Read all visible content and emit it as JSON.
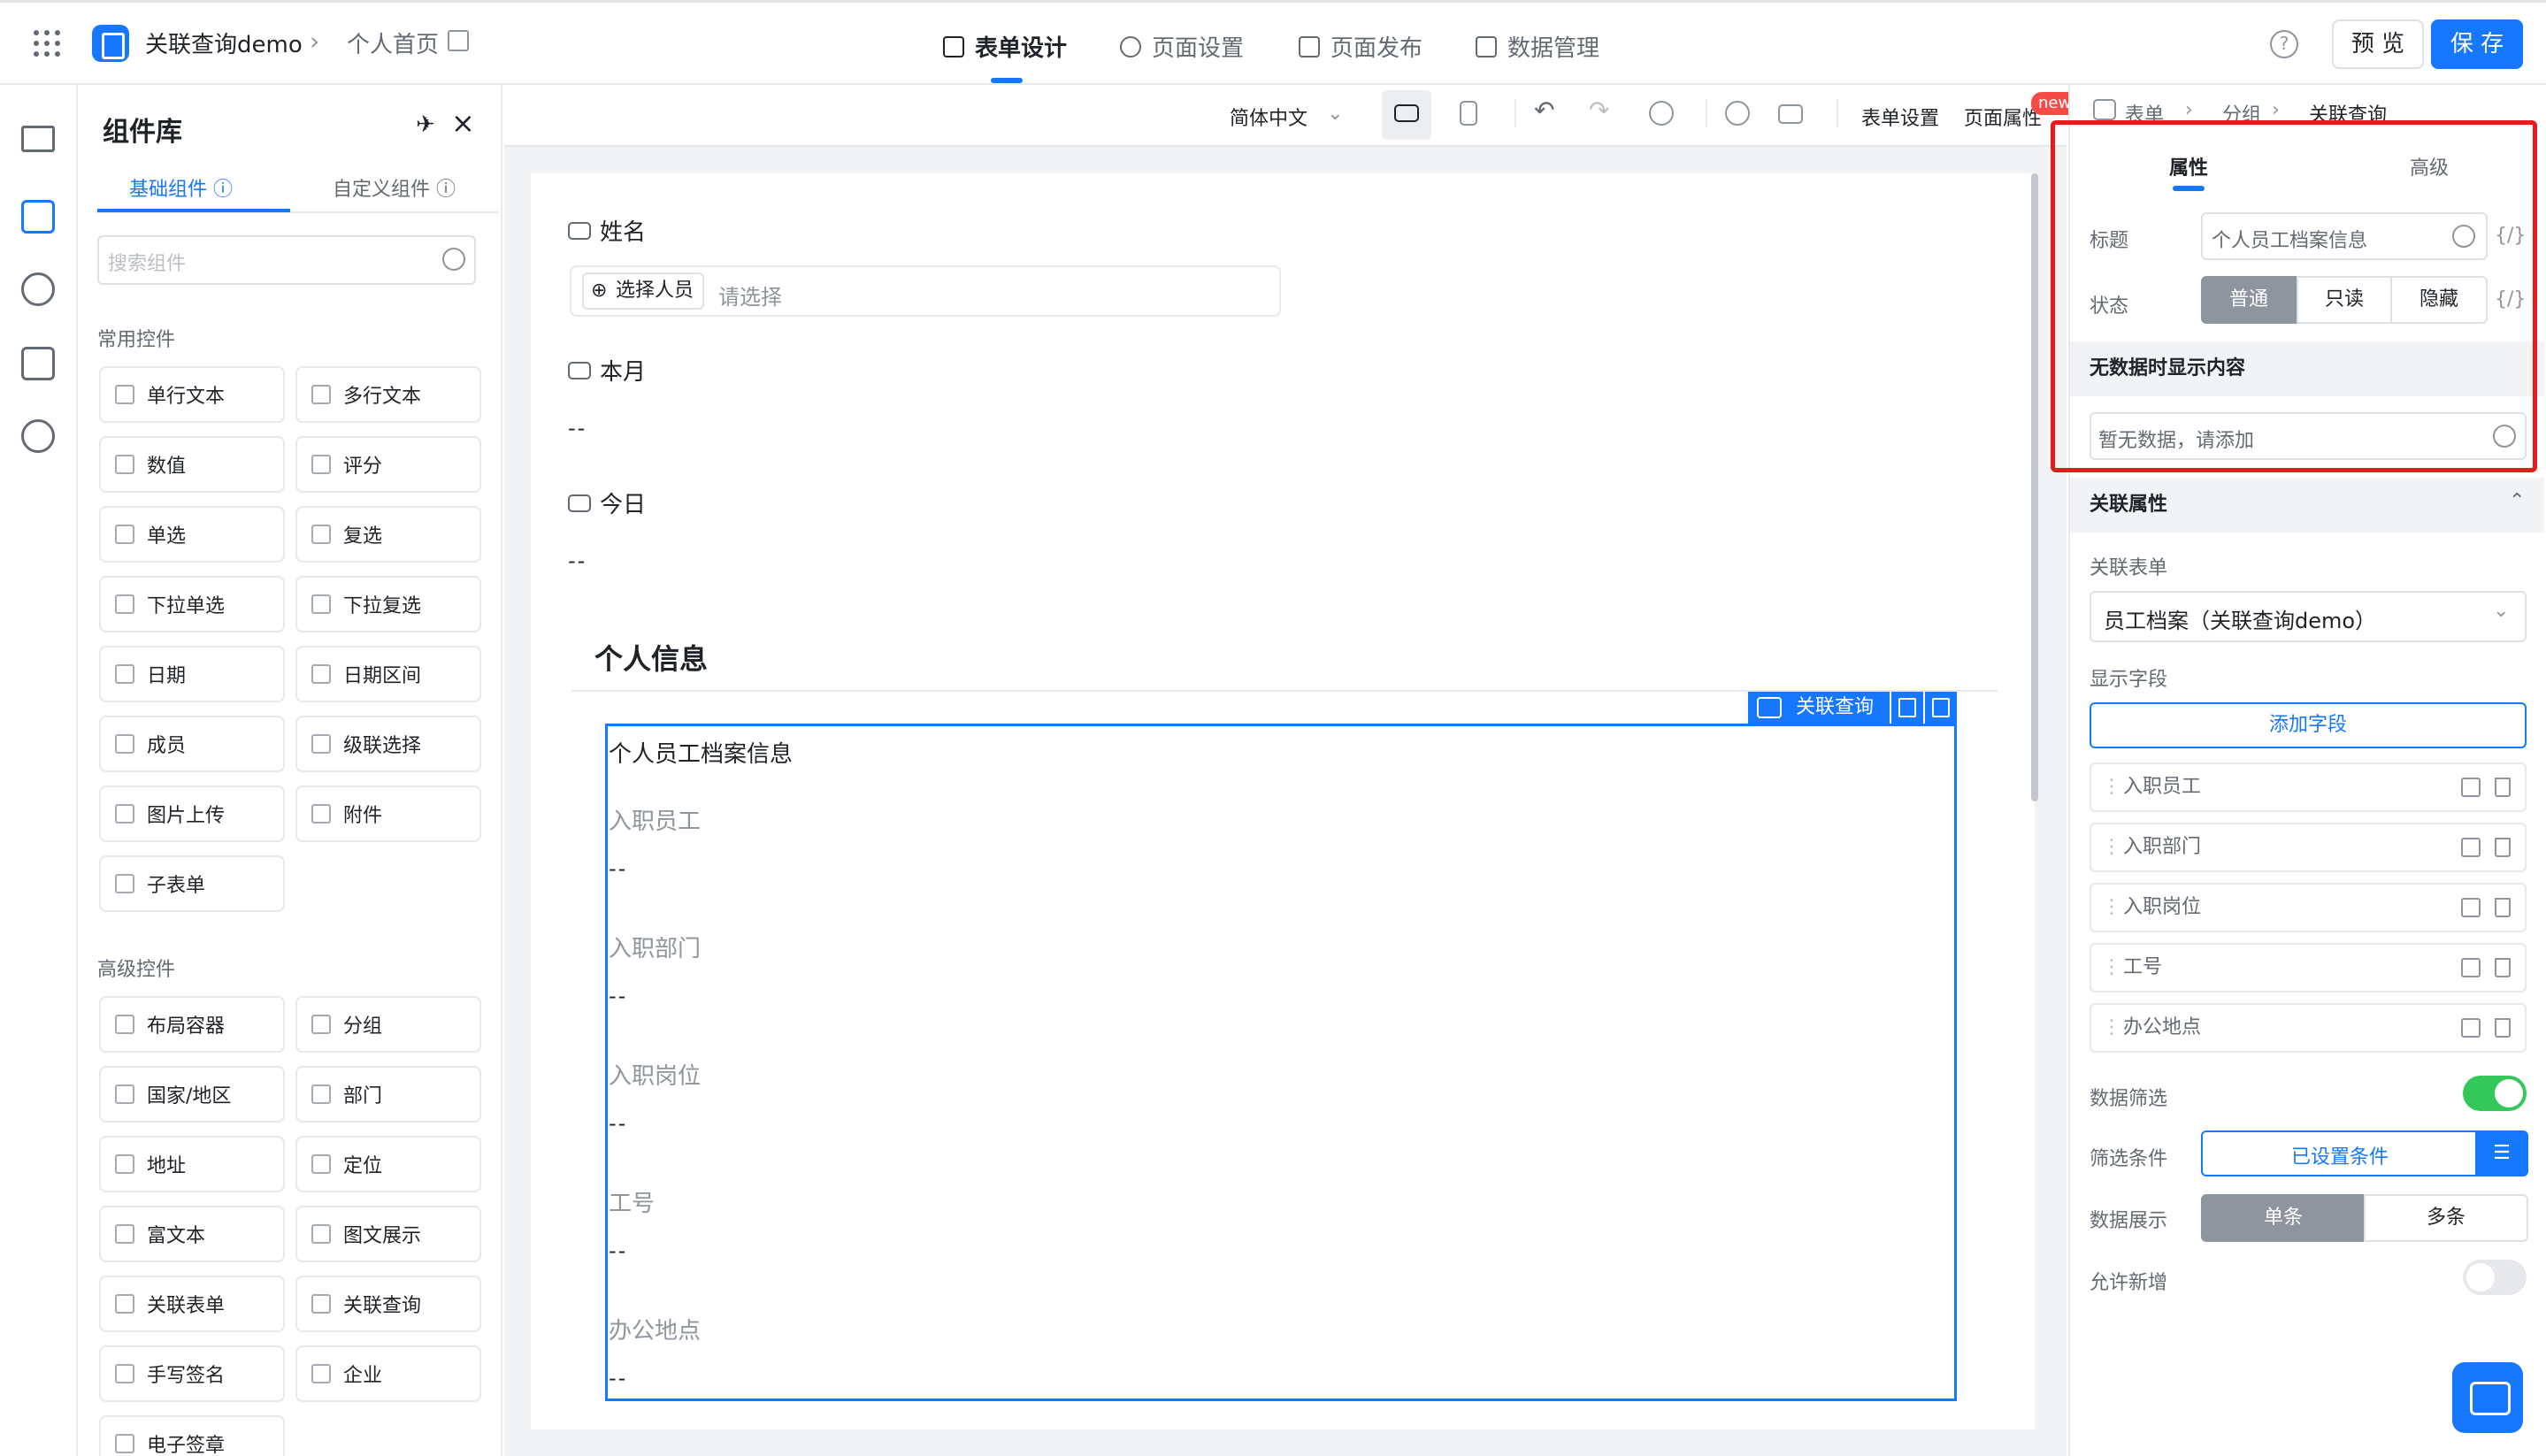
{
  "app": {
    "title": "关联查询demo",
    "page": "个人首页"
  },
  "nav_tabs": [
    {
      "label": "表单设计",
      "icon": "form-icon",
      "active": true
    },
    {
      "label": "页面设置",
      "icon": "gear-icon",
      "active": false
    },
    {
      "label": "页面发布",
      "icon": "send-icon",
      "active": false
    },
    {
      "label": "数据管理",
      "icon": "table-icon",
      "active": false
    }
  ],
  "header": {
    "help": "?",
    "preview_label": "预 览",
    "save_label": "保 存"
  },
  "library": {
    "title": "组件库",
    "tabs": [
      "基础组件",
      "自定义组件"
    ],
    "search_placeholder": "搜索组件",
    "common_title": "常用控件",
    "common": [
      "单行文本",
      "多行文本",
      "数值",
      "评分",
      "单选",
      "复选",
      "下拉单选",
      "下拉复选",
      "日期",
      "日期区间",
      "成员",
      "级联选择",
      "图片上传",
      "附件",
      "子表单"
    ],
    "advanced_title": "高级控件",
    "advanced": [
      "布局容器",
      "分组",
      "国家/地区",
      "部门",
      "地址",
      "定位",
      "富文本",
      "图文展示",
      "关联表单",
      "关联查询",
      "手写签名",
      "企业",
      "电子签章"
    ]
  },
  "toolbar": {
    "language": "简体中文",
    "form_settings": "表单设置",
    "page_props": "页面属性",
    "new_badge": "new"
  },
  "canvas": {
    "fields": [
      {
        "label": "姓名",
        "button": "选择人员",
        "placeholder": "请选择"
      },
      {
        "label": "本月",
        "value": "--"
      },
      {
        "label": "今日",
        "value": "--"
      }
    ],
    "group_title": "个人信息",
    "selected_tag": "关联查询",
    "query": {
      "title": "个人员工档案信息",
      "fields": [
        {
          "label": "入职员工",
          "value": "--"
        },
        {
          "label": "入职部门",
          "value": "--"
        },
        {
          "label": "入职岗位",
          "value": "--"
        },
        {
          "label": "工号",
          "value": "--"
        },
        {
          "label": "办公地点",
          "value": "--"
        }
      ]
    }
  },
  "props": {
    "breadcrumb": [
      "表单",
      "分组",
      "关联查询"
    ],
    "tabs": [
      "属性",
      "高级"
    ],
    "title_label": "标题",
    "title_value": "个人员工档案信息",
    "fx": "{/}",
    "state_label": "状态",
    "states": [
      "普通",
      "只读",
      "隐藏"
    ],
    "empty_section": "无数据时显示内容",
    "empty_value": "暂无数据，请添加",
    "relation_section": "关联属性",
    "relation_form_label": "关联表单",
    "relation_form_value": "员工档案（关联查询demo）",
    "display_fields_label": "显示字段",
    "add_field": "添加字段",
    "display_fields": [
      "入职员工",
      "入职部门",
      "入职岗位",
      "工号",
      "办公地点"
    ],
    "filter_label": "数据筛选",
    "filter_enabled": true,
    "condition_label": "筛选条件",
    "condition_value": "已设置条件",
    "display_label": "数据展示",
    "display_modes": [
      "单条",
      "多条"
    ],
    "allow_add_label": "允许新增",
    "allow_add_enabled": false
  },
  "colors": {
    "accent": "#1677ff",
    "highlight": "#e8191b",
    "toggle_on": "#34c759"
  }
}
